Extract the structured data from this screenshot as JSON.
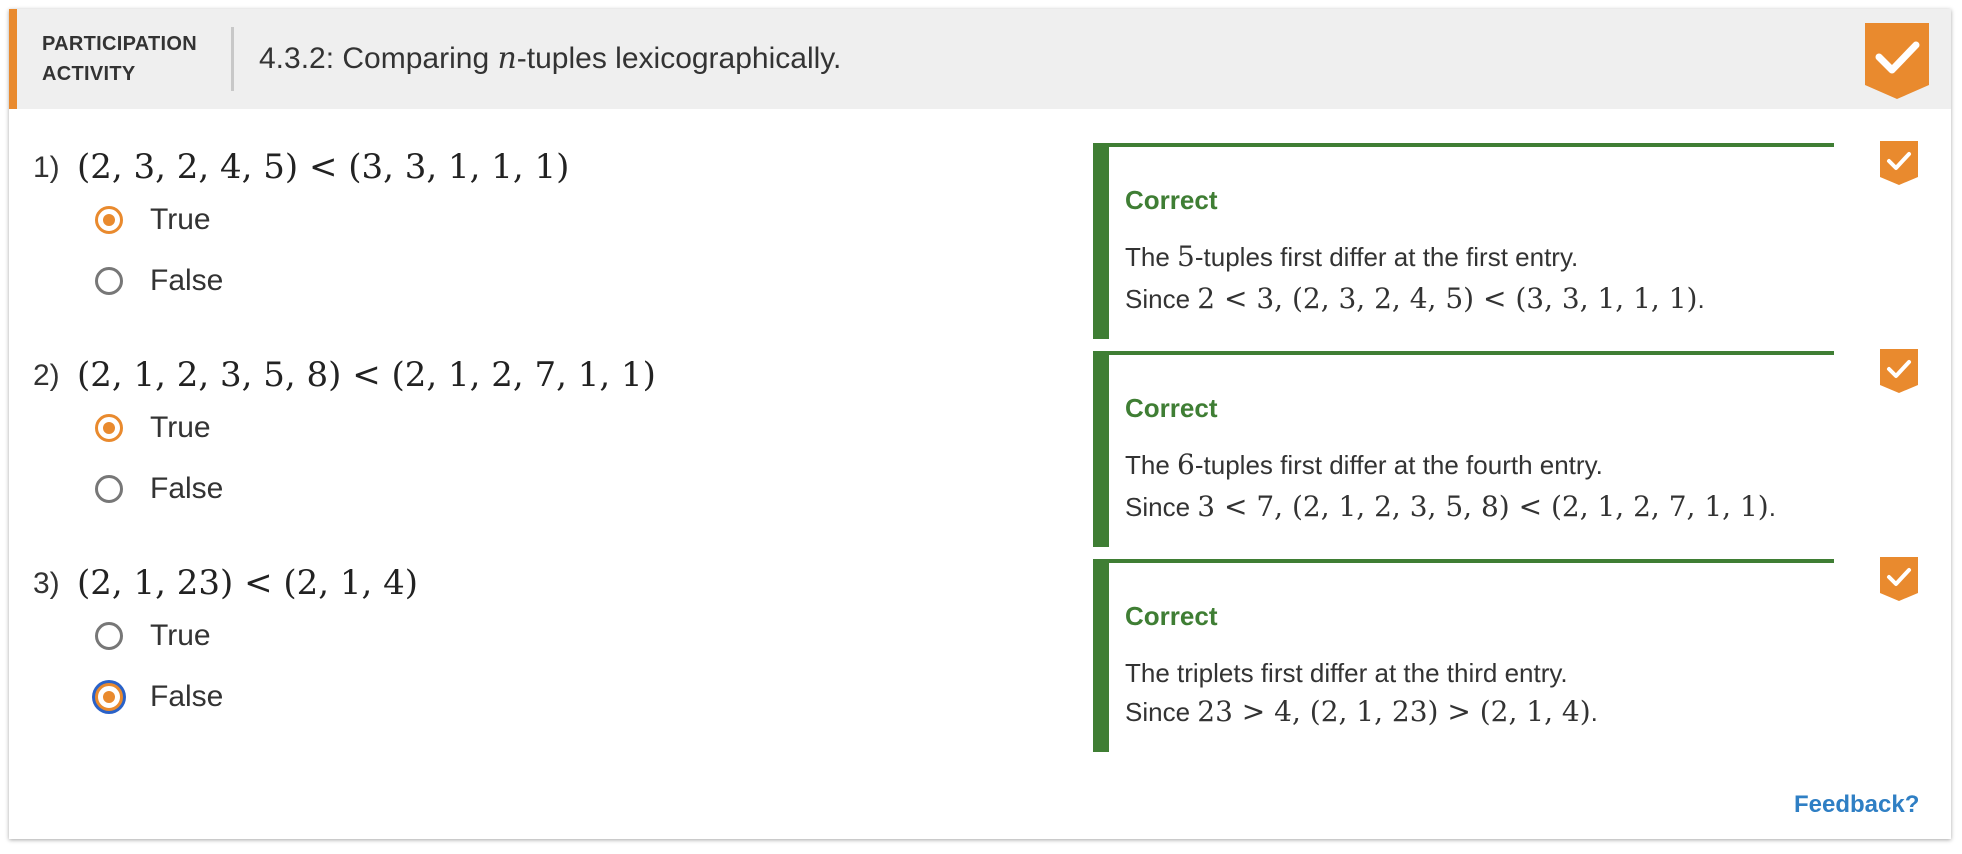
{
  "header": {
    "label_line1": "PARTICIPATION",
    "label_line2": "ACTIVITY",
    "title_prefix": "4.3.2: Comparing ",
    "title_var": "n",
    "title_suffix": "-tuples lexicographically.",
    "status_icon": "check-icon",
    "accent_color": "#e98a2e"
  },
  "questions": [
    {
      "number": "1)",
      "math": "(2, 3, 2, 4, 5) < (3, 3, 1, 1, 1)",
      "options": [
        {
          "label": "True",
          "selected": true
        },
        {
          "label": "False",
          "selected": false
        }
      ],
      "feedback": {
        "title": "Correct",
        "line1_pre": "The ",
        "line1_math": "5",
        "line1_post": "-tuples first differ at the first entry.",
        "line2_pre": "Since ",
        "line2_math": "2 < 3, (2, 3, 2, 4, 5) < (3, 3, 1, 1, 1)",
        "line2_post": "."
      }
    },
    {
      "number": "2)",
      "math": "(2, 1, 2, 3, 5, 8) < (2, 1, 2, 7, 1, 1)",
      "options": [
        {
          "label": "True",
          "selected": true
        },
        {
          "label": "False",
          "selected": false
        }
      ],
      "feedback": {
        "title": "Correct",
        "line1_pre": "The ",
        "line1_math": "6",
        "line1_post": "-tuples first differ at the fourth entry.",
        "line2_pre": "Since ",
        "line2_math": "3 < 7, (2, 1, 2, 3, 5, 8) < (2, 1, 2, 7, 1, 1)",
        "line2_post": "."
      }
    },
    {
      "number": "3)",
      "math": "(2, 1, 23) < (2, 1, 4)",
      "options": [
        {
          "label": "True",
          "selected": false
        },
        {
          "label": "False",
          "selected": true
        }
      ],
      "feedback": {
        "title": "Correct",
        "line1_pre": "The triplets first differ at the third entry.",
        "line1_math": "",
        "line1_post": "",
        "line2_pre": "Since ",
        "line2_math": "23 > 4, (2, 1, 23) > (2, 1, 4)",
        "line2_post": "."
      }
    }
  ],
  "feedback_link": "Feedback?",
  "colors": {
    "correct_green": "#3f7e34",
    "link_blue": "#2f7fc4",
    "radio_orange": "#e98a2e"
  }
}
